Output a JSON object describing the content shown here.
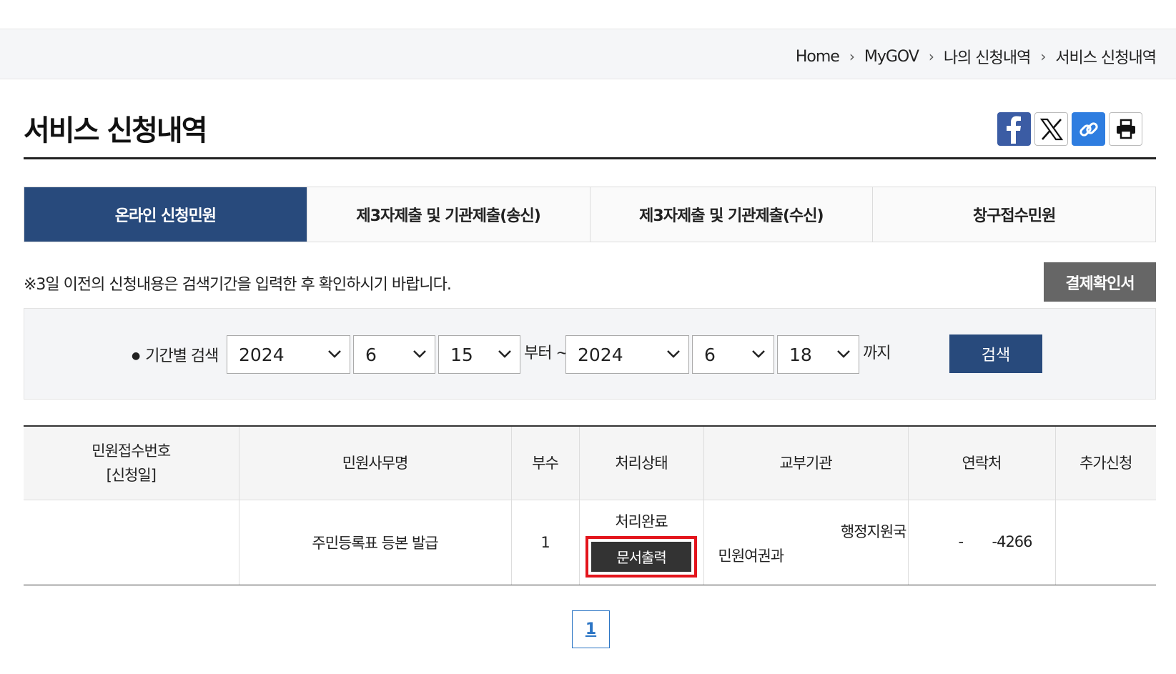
{
  "breadcrumb": {
    "items": [
      "Home",
      "MyGOV",
      "나의 신청내역",
      "서비스 신청내역"
    ]
  },
  "page": {
    "title": "서비스 신청내역"
  },
  "share": {
    "icons": [
      "facebook-icon",
      "x-twitter-icon",
      "link-copy-icon",
      "print-icon"
    ],
    "colors": {
      "facebook": "#3b5ca4",
      "link": "#2e7de0"
    }
  },
  "tabs": [
    {
      "label": "온라인 신청민원",
      "active": true
    },
    {
      "label": "제3자제출 및 기관제출(송신)",
      "active": false
    },
    {
      "label": "제3자제출 및 기관제출(수신)",
      "active": false
    },
    {
      "label": "창구접수민원",
      "active": false
    }
  ],
  "notice": "※3일 이전의 신청내용은 검색기간을 입력한 후 확인하시기 바랍니다.",
  "receipt_button": "결제확인서",
  "search": {
    "label": "기간별 검색",
    "from": {
      "year": "2024",
      "month": "6",
      "day": "15"
    },
    "from_suffix": "부터 ~",
    "to": {
      "year": "2024",
      "month": "6",
      "day": "18"
    },
    "to_suffix": "까지",
    "button": "검색"
  },
  "table": {
    "headers": [
      "민원접수번호",
      "[신청일]",
      "민원사무명",
      "부수",
      "처리상태",
      "교부기관",
      "연락처",
      "추가신청"
    ],
    "row": {
      "receipt_no": "",
      "service_name": "주민등록표 등본 발급",
      "copies": "1",
      "status": "처리완료",
      "print_button": "문서출력",
      "agency_line1": "행정지원국",
      "agency_line2": "민원여권과",
      "contact_prefix": "-",
      "contact_suffix": "-4266",
      "extra": ""
    }
  },
  "pagination": {
    "current": "1"
  },
  "colors": {
    "primary": "#284a7c",
    "highlight": "#e3141c",
    "page_link": "#2a74c4"
  }
}
